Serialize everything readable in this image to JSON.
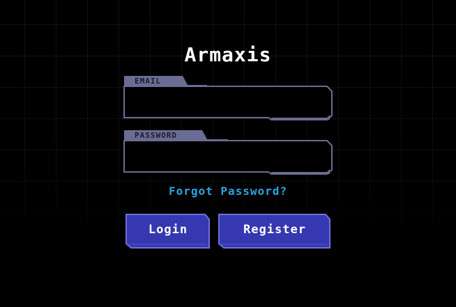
{
  "app": {
    "title": "Armaxis"
  },
  "form": {
    "email": {
      "label": "EMAIL",
      "value": "",
      "placeholder": ""
    },
    "password": {
      "label": "PASSWORD",
      "value": "",
      "placeholder": ""
    },
    "forgot_label": "Forgot Password?",
    "login_label": "Login",
    "register_label": "Register"
  },
  "colors": {
    "background": "#000000",
    "field_border": "#6b6c93",
    "label_tab": "#6b6c93",
    "link": "#2ea3e0",
    "button_fill": "#3538b0",
    "button_border": "#6e72d8"
  }
}
